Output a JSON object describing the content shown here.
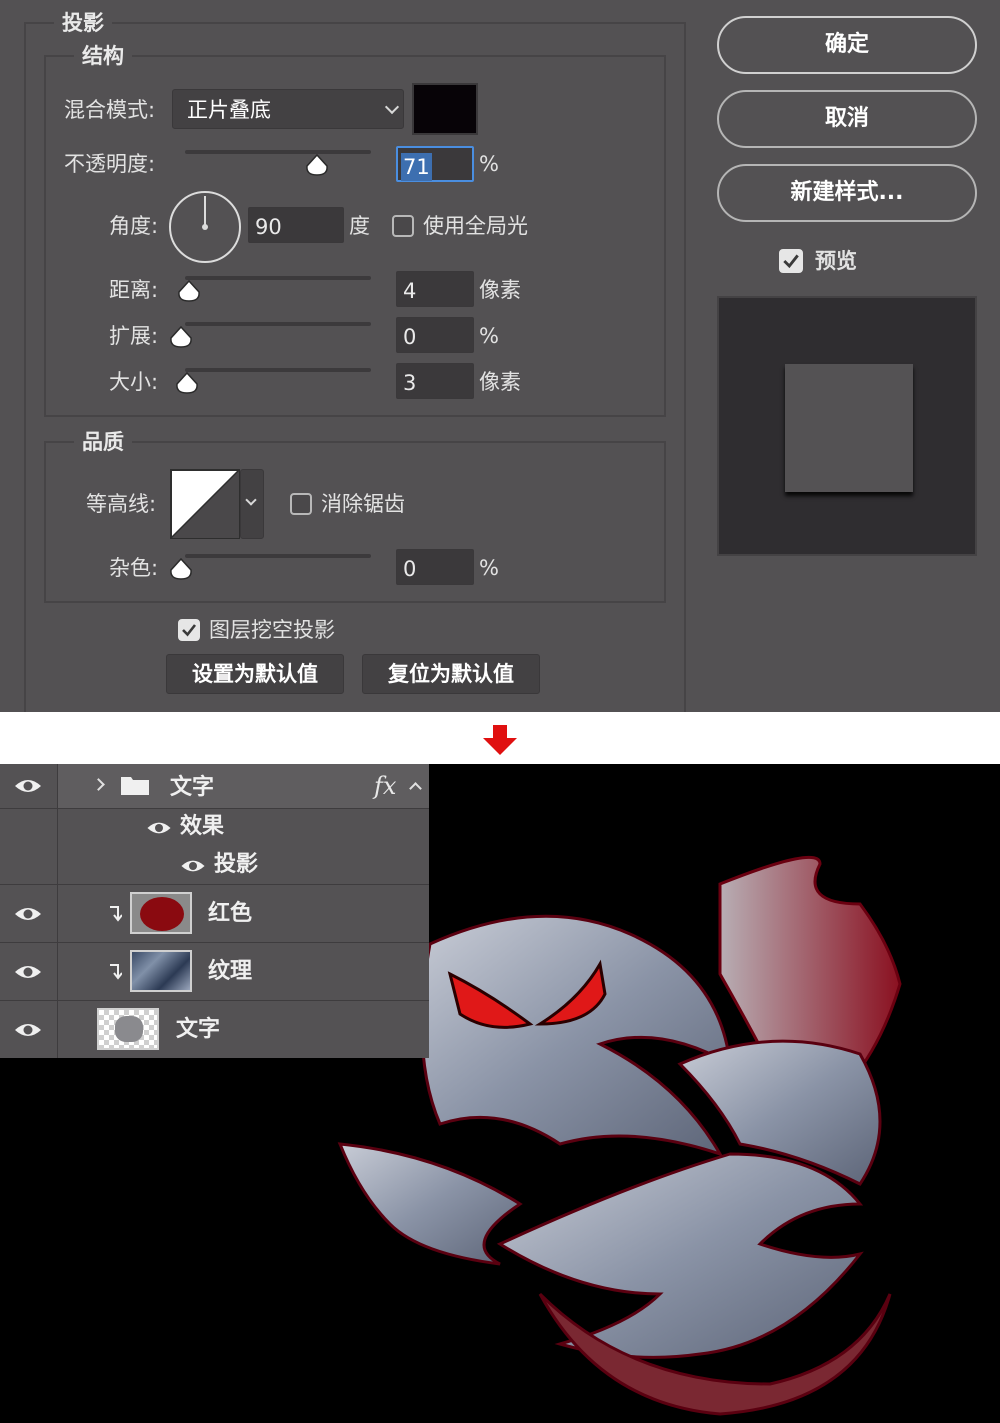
{
  "dialog": {
    "section_title": "投影",
    "structure": {
      "title": "结构",
      "blend_mode_label": "混合模式:",
      "blend_mode_value": "正片叠底",
      "blend_color": "#070307",
      "opacity_label": "不透明度:",
      "opacity_value": "71",
      "opacity_unit": "%",
      "opacity": 0.71,
      "angle_label": "角度:",
      "angle_value": "90",
      "angle_unit": "度",
      "global_light_label": "使用全局光",
      "global_light_checked": false,
      "distance_label": "距离:",
      "distance_value": "4",
      "distance_unit": "像素",
      "spread_label": "扩展:",
      "spread_value": "0",
      "spread_unit": "%",
      "size_label": "大小:",
      "size_value": "3",
      "size_unit": "像素"
    },
    "quality": {
      "title": "品质",
      "contour_label": "等高线:",
      "anti_alias_label": "消除锯齿",
      "anti_alias_checked": false,
      "noise_label": "杂色:",
      "noise_value": "0",
      "noise_unit": "%"
    },
    "knockout_label": "图层挖空投影",
    "knockout_checked": true,
    "make_default_label": "设置为默认值",
    "reset_default_label": "复位为默认值",
    "ok_label": "确定",
    "cancel_label": "取消",
    "new_style_label": "新建样式...",
    "preview_label": "预览",
    "preview_checked": true
  },
  "arrow_color": "#e01010",
  "layers": {
    "group_name": "文字",
    "fx_label": "fx",
    "effects_label": "效果",
    "effect_item": "投影",
    "rows": [
      {
        "name": "红色"
      },
      {
        "name": "纹理"
      },
      {
        "name": "文字"
      }
    ]
  }
}
